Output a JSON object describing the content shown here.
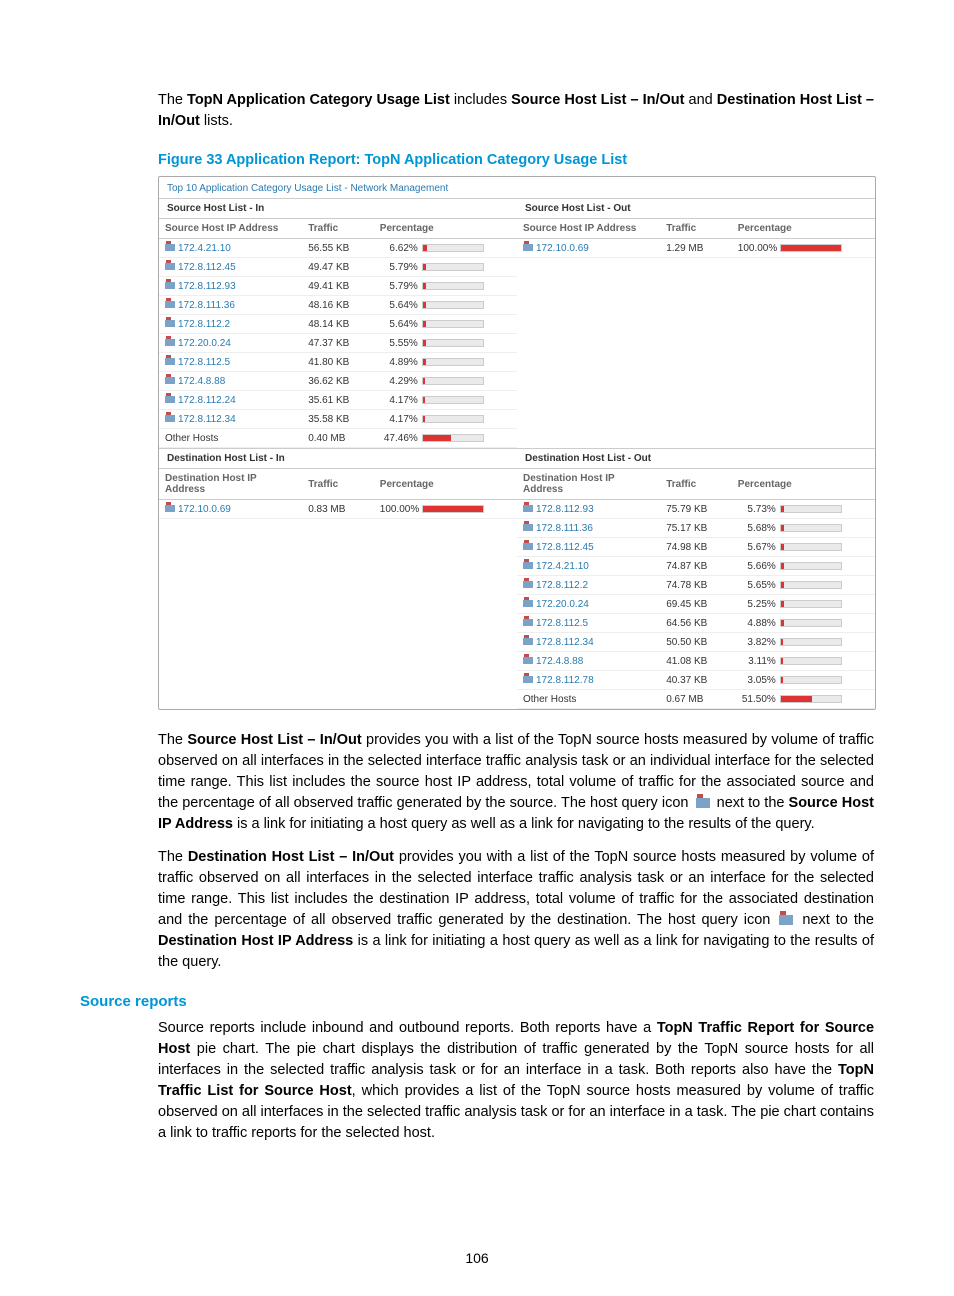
{
  "intro": {
    "line1_a": "The ",
    "line1_b": "TopN Application Category Usage List",
    "line1_c": " includes ",
    "line1_d": "Source Host List – In/Out",
    "line1_e": " and ",
    "line1_f": "Destination Host List – In/Out",
    "line1_g": " lists."
  },
  "figure_caption": "Figure 33 Application Report: TopN Application Category Usage List",
  "screenshot": {
    "title": "Top 10 Application Category Usage List - Network Management",
    "source_in_header": "Source Host List - In",
    "source_out_header": "Source Host List - Out",
    "dest_in_header": "Destination Host List - In",
    "dest_out_header": "Destination Host List - Out",
    "col_src_ip": "Source Host IP Address",
    "col_dst_ip": "Destination Host IP Address",
    "col_traffic": "Traffic",
    "col_pct": "Percentage",
    "other_hosts": "Other Hosts",
    "source_in": [
      {
        "ip": "172.4.21.10",
        "traffic": "56.55 KB",
        "pct": "6.62%"
      },
      {
        "ip": "172.8.112.45",
        "traffic": "49.47 KB",
        "pct": "5.79%"
      },
      {
        "ip": "172.8.112.93",
        "traffic": "49.41 KB",
        "pct": "5.79%"
      },
      {
        "ip": "172.8.111.36",
        "traffic": "48.16 KB",
        "pct": "5.64%"
      },
      {
        "ip": "172.8.112.2",
        "traffic": "48.14 KB",
        "pct": "5.64%"
      },
      {
        "ip": "172.20.0.24",
        "traffic": "47.37 KB",
        "pct": "5.55%"
      },
      {
        "ip": "172.8.112.5",
        "traffic": "41.80 KB",
        "pct": "4.89%"
      },
      {
        "ip": "172.4.8.88",
        "traffic": "36.62 KB",
        "pct": "4.29%"
      },
      {
        "ip": "172.8.112.24",
        "traffic": "35.61 KB",
        "pct": "4.17%"
      },
      {
        "ip": "172.8.112.34",
        "traffic": "35.58 KB",
        "pct": "4.17%"
      }
    ],
    "source_in_other": {
      "traffic": "0.40 MB",
      "pct": "47.46%"
    },
    "source_out": [
      {
        "ip": "172.10.0.69",
        "traffic": "1.29 MB",
        "pct": "100.00%"
      }
    ],
    "dest_in": [
      {
        "ip": "172.10.0.69",
        "traffic": "0.83 MB",
        "pct": "100.00%"
      }
    ],
    "dest_out": [
      {
        "ip": "172.8.112.93",
        "traffic": "75.79 KB",
        "pct": "5.73%"
      },
      {
        "ip": "172.8.111.36",
        "traffic": "75.17 KB",
        "pct": "5.68%"
      },
      {
        "ip": "172.8.112.45",
        "traffic": "74.98 KB",
        "pct": "5.67%"
      },
      {
        "ip": "172.4.21.10",
        "traffic": "74.87 KB",
        "pct": "5.66%"
      },
      {
        "ip": "172.8.112.2",
        "traffic": "74.78 KB",
        "pct": "5.65%"
      },
      {
        "ip": "172.20.0.24",
        "traffic": "69.45 KB",
        "pct": "5.25%"
      },
      {
        "ip": "172.8.112.5",
        "traffic": "64.56 KB",
        "pct": "4.88%"
      },
      {
        "ip": "172.8.112.34",
        "traffic": "50.50 KB",
        "pct": "3.82%"
      },
      {
        "ip": "172.4.8.88",
        "traffic": "41.08 KB",
        "pct": "3.11%"
      },
      {
        "ip": "172.8.112.78",
        "traffic": "40.37 KB",
        "pct": "3.05%"
      }
    ],
    "dest_out_other": {
      "traffic": "0.67 MB",
      "pct": "51.50%"
    }
  },
  "para_src_1a": "The ",
  "para_src_1b": "Source Host List – In/Out",
  "para_src_1c": " provides you with a list of the TopN source hosts measured by volume of traffic observed on all interfaces in the selected interface traffic analysis task or an individual interface for the selected time range. This list includes the source host IP address, total volume of traffic for the associated source and the percentage of all observed traffic generated by the source. The host query icon ",
  "para_src_1d": " next to the ",
  "para_src_1e": "Source Host IP Address",
  "para_src_1f": " is a link for initiating a host query as well as a link for navigating to the results of the query.",
  "para_dst_1a": "The ",
  "para_dst_1b": "Destination Host List – In/Out",
  "para_dst_1c": " provides you with a list of the TopN source hosts measured by volume of traffic observed on all interfaces in the selected interface traffic analysis task or an interface for the selected time range. This list includes the destination IP address, total volume of traffic for the associated destination and the percentage of all observed traffic generated by the destination. The host query icon ",
  "para_dst_1d": " next to the ",
  "para_dst_1e": "Destination Host IP Address",
  "para_dst_1f": " is a link for initiating a host query as well as a link for navigating to the results of the query.",
  "section_header": "Source reports",
  "para_source_a": "Source reports include inbound and outbound reports. Both reports have a ",
  "para_source_b": "TopN Traffic Report for Source Host",
  "para_source_c": " pie chart. The pie chart displays the distribution of traffic generated by the TopN source hosts for all interfaces in the selected traffic analysis task or for an interface in a task. Both reports also have the ",
  "para_source_d": "TopN Traffic List for Source Host",
  "para_source_e": ", which provides a list of the TopN source hosts measured by volume of traffic observed on all interfaces in the selected traffic analysis task or for an interface in a task. The pie chart contains a link to traffic reports for the selected host.",
  "page_number": "106"
}
